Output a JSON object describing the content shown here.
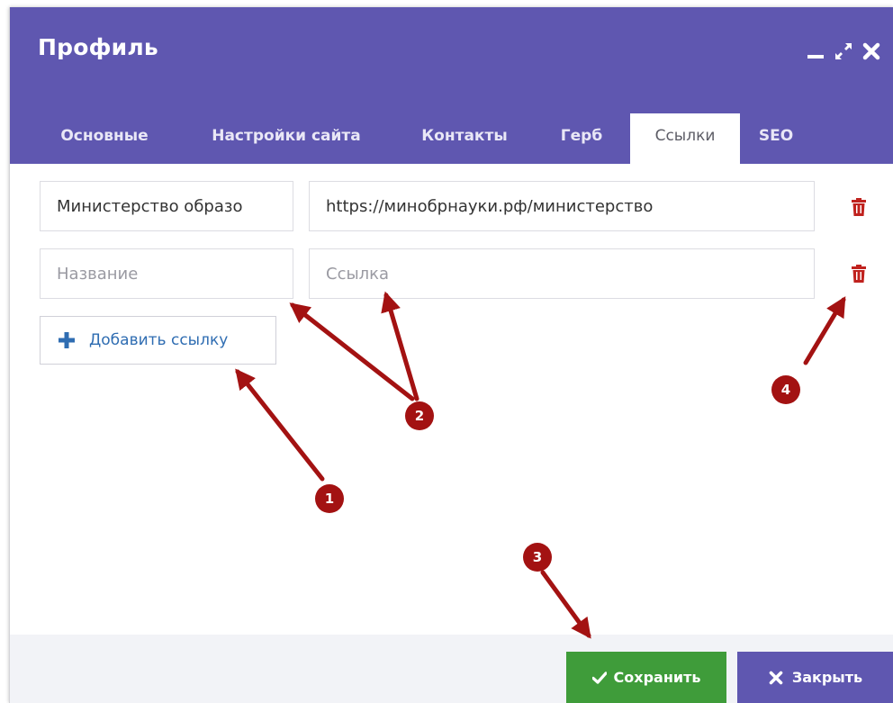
{
  "window": {
    "title": "Профиль",
    "controls": [
      "minimize-icon",
      "maximize-icon",
      "close-icon"
    ]
  },
  "tabs": [
    {
      "label": "Основные",
      "active": false
    },
    {
      "label": "Настройки сайта",
      "active": false
    },
    {
      "label": "Контакты",
      "active": false
    },
    {
      "label": "Герб",
      "active": false
    },
    {
      "label": "Ссылки",
      "active": true
    },
    {
      "label": "SEO",
      "active": false
    }
  ],
  "links": [
    {
      "name_value": "Министерство образо",
      "name_placeholder": "Название",
      "url_value": "https://минобрнауки.рф/министерство",
      "url_placeholder": "Ссылка"
    },
    {
      "name_value": "",
      "name_placeholder": "Название",
      "url_value": "",
      "url_placeholder": "Ссылка"
    }
  ],
  "add_link_label": "Добавить ссылку",
  "footer": {
    "save_label": "Сохранить",
    "close_label": "Закрыть"
  },
  "annotations": [
    "1",
    "2",
    "3",
    "4"
  ],
  "colors": {
    "header": "#5f57b0",
    "save": "#3f9c3a",
    "trash": "#c0221e",
    "annotation": "#a31212",
    "link_text": "#2f6db2"
  }
}
